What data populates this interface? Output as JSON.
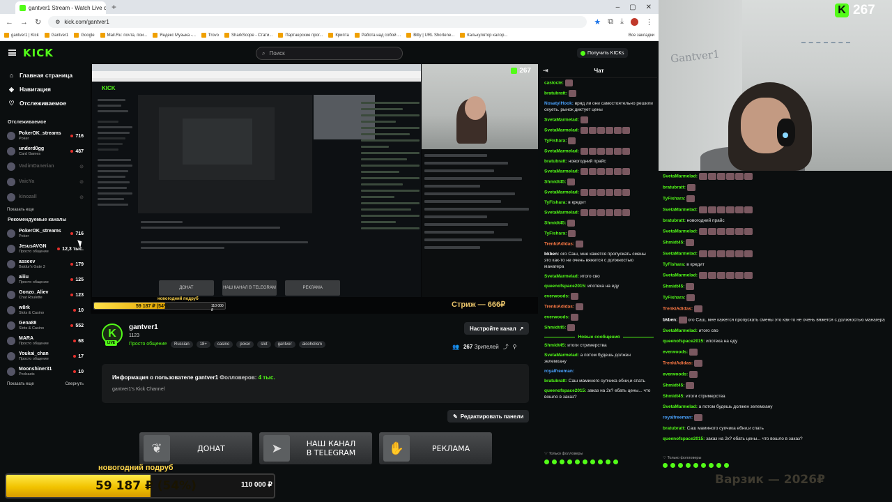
{
  "browser": {
    "tab_title": "gantver1 Stream - Watch Live o...",
    "url": "kick.com/gantver1",
    "bookmarks": [
      "gantver1 | Kick",
      "Gantver1",
      "Google",
      "Mail.Ru: почта, пои...",
      "Яндекс Музыка -...",
      "Trovo",
      "SharkScope - Стати...",
      "Партнерские прог...",
      "Крипта",
      "Работа над собой ...",
      "Bitly | URL Shortene...",
      "Калькулятор калор..."
    ],
    "bookmarks_all": "Все закладки"
  },
  "header": {
    "logo": "KICK",
    "search_placeholder": "Поиск",
    "kicks_button": "Получить KICKs"
  },
  "sidebar": {
    "nav": [
      {
        "label": "Главная страница",
        "icon": "home-icon"
      },
      {
        "label": "Навигация",
        "icon": "compass-icon"
      },
      {
        "label": "Отслеживаемое",
        "icon": "heart-icon"
      }
    ],
    "following_title": "Отслеживаемое",
    "following": [
      {
        "name": "PokerOK_streams",
        "game": "Poker",
        "viewers": "716"
      },
      {
        "name": "underd0gg",
        "game": "Card Games",
        "viewers": "487"
      },
      {
        "name": "VadimDanerian",
        "game": "",
        "viewers": ""
      },
      {
        "name": "VaicYa",
        "game": "",
        "viewers": ""
      },
      {
        "name": "kinozall",
        "game": "",
        "viewers": ""
      }
    ],
    "show_more": "Показать еще",
    "recommended_title": "Рекомендуемые каналы",
    "recommended": [
      {
        "name": "PokerOK_streams",
        "game": "Poker",
        "viewers": "716"
      },
      {
        "name": "JesusAVGN",
        "game": "Просто общение",
        "viewers": "12,3 тыс."
      },
      {
        "name": "asseev",
        "game": "Baldur's Gate 3",
        "viewers": "179"
      },
      {
        "name": "aiiiu",
        "game": "Просто общение",
        "viewers": "125"
      },
      {
        "name": "Gonzo_Aliev",
        "game": "Chat Roulette",
        "viewers": "123"
      },
      {
        "name": "w8rk",
        "game": "Slots & Casino",
        "viewers": "10"
      },
      {
        "name": "Gena88",
        "game": "Slots & Casino",
        "viewers": "552"
      },
      {
        "name": "MARA",
        "game": "Просто общение",
        "viewers": "68"
      },
      {
        "name": "Youkai_chan",
        "game": "Просто общение",
        "viewers": "17"
      },
      {
        "name": "Moonshiner31",
        "game": "Podcasts",
        "viewers": "10"
      }
    ],
    "show_more2": "Показать еще",
    "collapse": "Свернуть"
  },
  "player": {
    "viewer_count": "267",
    "goal_label": "новогодний подруб",
    "goal_value": "59 187 ₽ (54%)",
    "goal_target": "110 000 ₽",
    "goal_fraction": 0.54,
    "strizh": "Стриж — 666₽",
    "mini_panels": [
      "ДОНАТ",
      "НАШ КАНАЛ В TELEGRAM",
      "РЕКЛАМА"
    ]
  },
  "stream": {
    "channel": "gantver1",
    "followers_count": "1123",
    "category": "Просто общение",
    "tags": [
      "Russian",
      "18+",
      "casino",
      "poker",
      "slot",
      "gantver",
      "alcoholism"
    ],
    "setup_button": "Настройте канал",
    "viewers": "267",
    "viewers_label": "Зрителей",
    "about_title": "Информация о пользователе gantver1",
    "followers_label": "Фолловеров:",
    "followers_value": "4 тыс.",
    "about_desc": "gantver1's Kick Channel",
    "edit_button": "Редактировать панели",
    "panels": [
      {
        "line1": "ДОНАТ",
        "line2": ""
      },
      {
        "line1": "НАШ КАНАЛ",
        "line2": "В TELEGRAM"
      },
      {
        "line1": "РЕКЛАМА",
        "line2": ""
      }
    ]
  },
  "chat": {
    "title": "Чат",
    "messages": [
      {
        "user": "casiocie:",
        "color": "#53fc18",
        "text": "",
        "emotes": 1
      },
      {
        "user": "bratubratt:",
        "color": "#53fc18",
        "text": "",
        "emotes": 1
      },
      {
        "user": "NosatyiHook:",
        "color": "#4aa3ff",
        "text": "вряд ли они самостоятельно решили охуеть. рынок диктует цены",
        "emotes": 0
      },
      {
        "user": "SvetaMarmelad:",
        "color": "#53fc18",
        "text": "",
        "emotes": 1
      },
      {
        "user": "SvetaMarmelad:",
        "color": "#53fc18",
        "text": "",
        "emotes": 6
      },
      {
        "user": "TyFishara:",
        "color": "#53fc18",
        "text": "",
        "emotes": 1
      },
      {
        "user": "SvetaMarmelad:",
        "color": "#53fc18",
        "text": "",
        "emotes": 6
      },
      {
        "user": "bratubratt:",
        "color": "#53fc18",
        "text": "новогодний прайс",
        "emotes": 0
      },
      {
        "user": "SvetaMarmelad:",
        "color": "#53fc18",
        "text": "",
        "emotes": 6
      },
      {
        "user": "Shmidt45:",
        "color": "#53fc18",
        "text": "",
        "emotes": 1
      },
      {
        "user": "SvetaMarmelad:",
        "color": "#53fc18",
        "text": "",
        "emotes": 6
      },
      {
        "user": "TyFishara:",
        "color": "#53fc18",
        "text": "в кредит",
        "emotes": 0
      },
      {
        "user": "SvetaMarmelad:",
        "color": "#53fc18",
        "text": "",
        "emotes": 6
      },
      {
        "user": "Shmidt45:",
        "color": "#53fc18",
        "text": "",
        "emotes": 1
      },
      {
        "user": "TyFishara:",
        "color": "#53fc18",
        "text": "",
        "emotes": 1
      },
      {
        "user": "TrenkiAdidas:",
        "color": "#ff7a45",
        "text": "",
        "emotes": 1
      },
      {
        "user": "bkben:",
        "color": "#ffffff",
        "text": "ого Саш, мне кажется пропускать смены это как-то не очень вяжется с должностью манагера",
        "emotes": 0
      },
      {
        "user": "SvetaMarmelad:",
        "color": "#53fc18",
        "text": "итого сво",
        "emotes": 0
      },
      {
        "user": "queenofspace2015:",
        "color": "#53fc18",
        "text": "ипотека на еду",
        "emotes": 0
      },
      {
        "user": "everwoods:",
        "color": "#53fc18",
        "text": "",
        "emotes": 1
      },
      {
        "user": "TrenkiAdidas:",
        "color": "#ff7a45",
        "text": "",
        "emotes": 1
      },
      {
        "user": "everwoods:",
        "color": "#53fc18",
        "text": "",
        "emotes": 1
      },
      {
        "user": "Shmidt45:",
        "color": "#53fc18",
        "text": "",
        "emotes": 1
      }
    ],
    "new_messages": "Новые сообщения",
    "messages_after": [
      {
        "user": "Shmidt45:",
        "color": "#53fc18",
        "text": "итоги стримерства"
      },
      {
        "user": "SvetaMarmelad:",
        "color": "#53fc18",
        "text": "а потом будешь должен зелемхану"
      },
      {
        "user": "royalfreeman:",
        "color": "#4aa3ff",
        "text": ""
      },
      {
        "user": "bratubratt:",
        "color": "#53fc18",
        "text": "Саш маминого супчика ебни,и спать"
      },
      {
        "user": "queenofspace2015:",
        "color": "#53fc18",
        "text": "заказ на 2к? ебать цены... что вошло в заказ?"
      }
    ],
    "followers_only": "Только фолловеры"
  },
  "overlay": {
    "viewer_count": "267",
    "cam_label": "Gantver1",
    "varzik": "Варзик — 2026₽",
    "right_messages": [
      {
        "user": "SvetaMarmelad:",
        "color": "#53fc18",
        "text": "",
        "emotes": 6
      },
      {
        "user": "bratubratt:",
        "color": "#53fc18",
        "text": "",
        "emotes": 1
      },
      {
        "user": "TyFishara:",
        "color": "#53fc18",
        "text": "",
        "emotes": 1
      },
      {
        "user": "SvetaMarmelad:",
        "color": "#53fc18",
        "text": "",
        "emotes": 6
      },
      {
        "user": "bratubratt:",
        "color": "#53fc18",
        "text": "новогодний прайс",
        "emotes": 0
      },
      {
        "user": "SvetaMarmelad:",
        "color": "#53fc18",
        "text": "",
        "emotes": 6
      },
      {
        "user": "Shmidt45:",
        "color": "#53fc18",
        "text": "",
        "emotes": 1
      },
      {
        "user": "SvetaMarmelad:",
        "color": "#53fc18",
        "text": "",
        "emotes": 6
      },
      {
        "user": "TyFishara:",
        "color": "#53fc18",
        "text": "в кредит",
        "emotes": 0
      },
      {
        "user": "SvetaMarmelad:",
        "color": "#53fc18",
        "text": "",
        "emotes": 6
      },
      {
        "user": "Shmidt45:",
        "color": "#53fc18",
        "text": "",
        "emotes": 1
      },
      {
        "user": "TyFishara:",
        "color": "#53fc18",
        "text": "",
        "emotes": 1
      },
      {
        "user": "TrenkiAdidas:",
        "color": "#ff7a45",
        "text": "",
        "emotes": 1
      },
      {
        "user": "bkben:",
        "color": "#ffffff",
        "text": "ого Саш, мне кажется пропускать смены это как-то не очень вяжется с должностью манагера",
        "emotes": 1
      },
      {
        "user": "SvetaMarmelad:",
        "color": "#53fc18",
        "text": "итого сво",
        "emotes": 0
      },
      {
        "user": "queenofspace2015:",
        "color": "#53fc18",
        "text": "ипотека на еду",
        "emotes": 0
      },
      {
        "user": "everwoods:",
        "color": "#53fc18",
        "text": "",
        "emotes": 1
      },
      {
        "user": "TrenkiAdidas:",
        "color": "#ff7a45",
        "text": "",
        "emotes": 1
      },
      {
        "user": "everwoods:",
        "color": "#53fc18",
        "text": "",
        "emotes": 1
      },
      {
        "user": "Shmidt45:",
        "color": "#53fc18",
        "text": "",
        "emotes": 1
      },
      {
        "user": "Shmidt45:",
        "color": "#53fc18",
        "text": "итоги стримерства",
        "emotes": 0
      },
      {
        "user": "SvetaMarmelad:",
        "color": "#53fc18",
        "text": "а потом будешь должен зелемхану",
        "emotes": 0
      },
      {
        "user": "royalfreeman:",
        "color": "#4aa3ff",
        "text": "",
        "emotes": 1
      },
      {
        "user": "bratubratt:",
        "color": "#53fc18",
        "text": "Саш маминого супчика ебни,и спать",
        "emotes": 0
      },
      {
        "user": "queenofspace2015:",
        "color": "#53fc18",
        "text": "заказ на 2к? ебать цены... что вошло в заказ?",
        "emotes": 0
      }
    ],
    "followers_only": "Только фолловеры"
  },
  "goal": {
    "label": "новогодний подруб",
    "value": "59 187 ₽ (54%)",
    "target": "110 000 ₽",
    "fraction": 0.54
  },
  "colors": {
    "accent": "#53fc18",
    "goal": "#f1c300",
    "live_dot": "#e5312c"
  }
}
